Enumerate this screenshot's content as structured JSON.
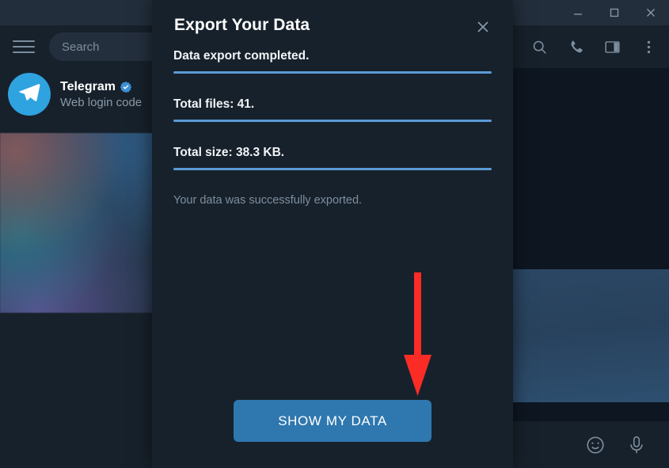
{
  "window": {
    "controls": [
      {
        "name": "minimize",
        "icon": "minimize-icon"
      },
      {
        "name": "maximize",
        "icon": "maximize-icon"
      },
      {
        "name": "close",
        "icon": "close-icon"
      }
    ]
  },
  "sidebar": {
    "menu_icon": "hamburger-menu-icon",
    "search": {
      "placeholder": "Search",
      "value": ""
    },
    "chats": [
      {
        "name": "Telegram",
        "verified": true,
        "preview": "Web login code",
        "avatar_icon": "telegram-paper-plane-icon"
      }
    ]
  },
  "chat_header": {
    "icons": [
      {
        "name": "search-icon"
      },
      {
        "name": "phone-call-icon"
      },
      {
        "name": "split-view-icon"
      },
      {
        "name": "more-options-icon"
      }
    ]
  },
  "composer": {
    "icons": [
      {
        "name": "emoji-smiley-icon"
      },
      {
        "name": "microphone-icon"
      }
    ]
  },
  "dialog": {
    "title": "Export Your Data",
    "close_icon": "close-icon",
    "steps": [
      {
        "label": "Data export completed.",
        "progress": 100
      },
      {
        "label": "Total files: 41.",
        "progress": 100
      },
      {
        "label": "Total size: 38.3 KB.",
        "progress": 100
      }
    ],
    "note": "Your data was successfully exported.",
    "primary_button": "SHOW MY DATA"
  },
  "annotation": {
    "arrow": {
      "name": "red-down-arrow",
      "direction": "down",
      "color": "#fb2c26",
      "points_to": "SHOW MY DATA"
    }
  },
  "colors": {
    "accent": "#2f77af",
    "progress": "#5b9ad5",
    "panel": "#17212b",
    "chat_bg": "#0e1621",
    "titlebar": "#232e3c",
    "annotation_red": "#fb2c26",
    "telegram_blue": "#2fa3e0"
  }
}
